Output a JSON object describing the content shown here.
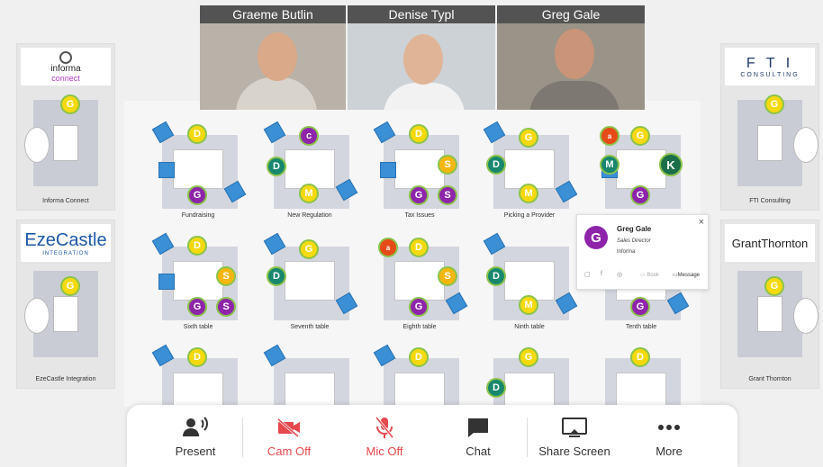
{
  "videos": [
    {
      "name": "Graeme Butlin"
    },
    {
      "name": "Denise Typl"
    },
    {
      "name": "Greg Gale"
    }
  ],
  "booths": {
    "informa": {
      "logo_top": "informa",
      "logo_bottom": "connect",
      "caption": "Informa Connect"
    },
    "fti": {
      "logo_top": "F T I",
      "logo_bottom": "CONSULTING",
      "caption": "FTI Consulting"
    },
    "ezecastle": {
      "logo_top": "EzeCastle",
      "logo_bottom": "INTEGRATION",
      "caption": "EzeCastle Integration"
    },
    "grant": {
      "logo_top": "GrantThornton",
      "caption": "Grant Thornton"
    }
  },
  "tables": [
    {
      "label": "Fundraising"
    },
    {
      "label": "New Regulation"
    },
    {
      "label": "Tax Issues"
    },
    {
      "label": "Picking a Provider"
    },
    {
      "label": ""
    },
    {
      "label": "Sixth table"
    },
    {
      "label": "Seventh table"
    },
    {
      "label": "Eighth table"
    },
    {
      "label": "Ninth table"
    },
    {
      "label": "Tenth table"
    }
  ],
  "popup": {
    "initial": "G",
    "name": "Greg Gale",
    "role": "Sales Director",
    "company": "Informa",
    "close": "×",
    "book": "Book",
    "message": "Message"
  },
  "toolbar": {
    "present": "Present",
    "cam_off": "Cam Off",
    "mic_off": "Mic Off",
    "chat": "Chat",
    "share_screen": "Share Screen",
    "more": "More"
  },
  "colors": {
    "accent_red": "#e5484d",
    "chair_blue": "#3b8fd4",
    "avatar_purple": "#8e24aa",
    "avatar_yellow": "#f5d90f"
  }
}
